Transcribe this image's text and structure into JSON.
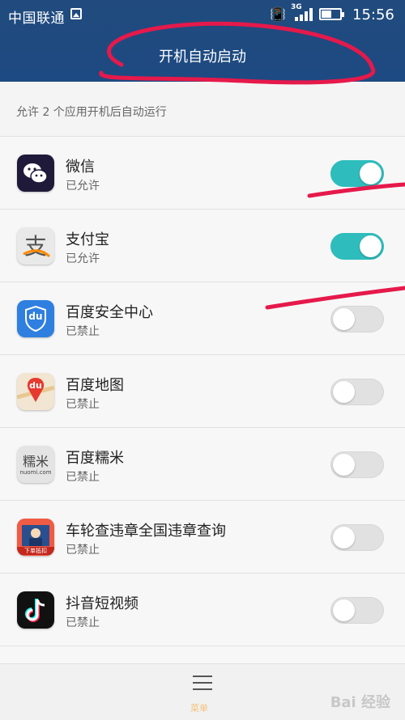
{
  "statusbar": {
    "carrier": "中国联通",
    "network": "3G",
    "time": "15:56"
  },
  "header": {
    "title": "开机自动启动"
  },
  "description": "允许 2 个应用开机后自动运行",
  "apps": [
    {
      "name": "微信",
      "status": "已允许",
      "enabled": true,
      "icon": "wechat-icon"
    },
    {
      "name": "支付宝",
      "status": "已允许",
      "enabled": true,
      "icon": "alipay-icon"
    },
    {
      "name": "百度安全中心",
      "status": "已禁止",
      "enabled": false,
      "icon": "baidu-security-icon"
    },
    {
      "name": "百度地图",
      "status": "已禁止",
      "enabled": false,
      "icon": "baidu-map-icon"
    },
    {
      "name": "百度糯米",
      "status": "已禁止",
      "enabled": false,
      "icon": "baidu-nuomi-icon"
    },
    {
      "name": "车轮查违章全国违章查询",
      "status": "已禁止",
      "enabled": false,
      "icon": "chelun-icon"
    },
    {
      "name": "抖音短视频",
      "status": "已禁止",
      "enabled": false,
      "icon": "douyin-icon"
    }
  ],
  "icon_text": {
    "baidu_security": "du",
    "baidu_map": "du",
    "nuomi_top": "糯米",
    "nuomi_bottom": "nuomi.com",
    "chelun": "下单抵扣"
  },
  "bottom": {
    "menu_label": "菜单"
  },
  "watermark": "Bai 经验",
  "colors": {
    "header": "#1f4b80",
    "toggle_on": "#2ebcbc",
    "annotation": "#e6194b"
  }
}
